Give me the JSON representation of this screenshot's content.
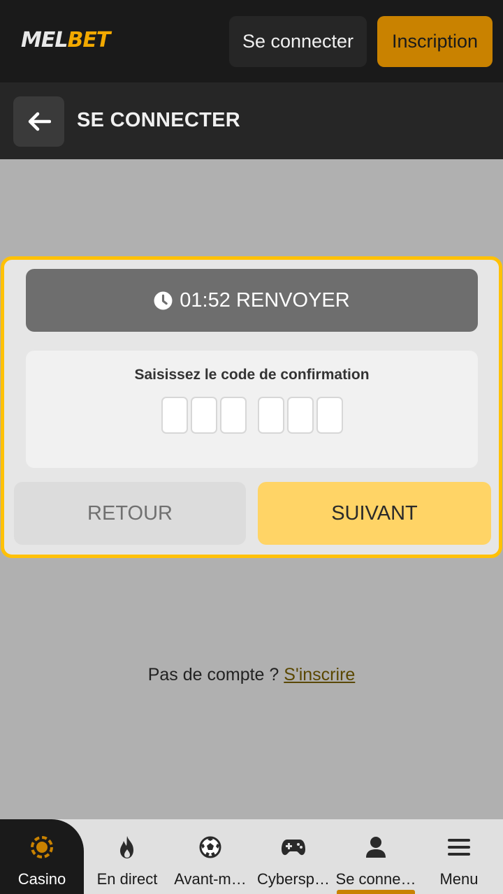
{
  "header": {
    "logo_left": "MEL",
    "logo_right": "BET",
    "login_label": "Se connecter",
    "register_label": "Inscription"
  },
  "subheader": {
    "title": "SE CONNECTER"
  },
  "dialog": {
    "timer": "01:52",
    "resend_label": "RENVOYER",
    "code_label": "Saisissez le code de confirmation",
    "code_digits": [
      "",
      "",
      "",
      "",
      "",
      ""
    ],
    "back_label": "RETOUR",
    "next_label": "SUIVANT"
  },
  "signup": {
    "prompt": "Pas de compte ?",
    "link": "S'inscrire"
  },
  "bottom_nav": [
    {
      "label": "Casino",
      "icon": "casino-chip-icon"
    },
    {
      "label": "En direct",
      "icon": "fire-icon"
    },
    {
      "label": "Avant-m…",
      "icon": "soccer-ball-icon"
    },
    {
      "label": "Cybersp…",
      "icon": "gamepad-icon"
    },
    {
      "label": "Se conne…",
      "icon": "user-icon",
      "active": true
    },
    {
      "label": "Menu",
      "icon": "hamburger-menu-icon"
    }
  ],
  "colors": {
    "accent": "#c98200",
    "highlight": "#ffc107",
    "next_button": "#ffd466",
    "header_bg": "#1a1a1a"
  }
}
